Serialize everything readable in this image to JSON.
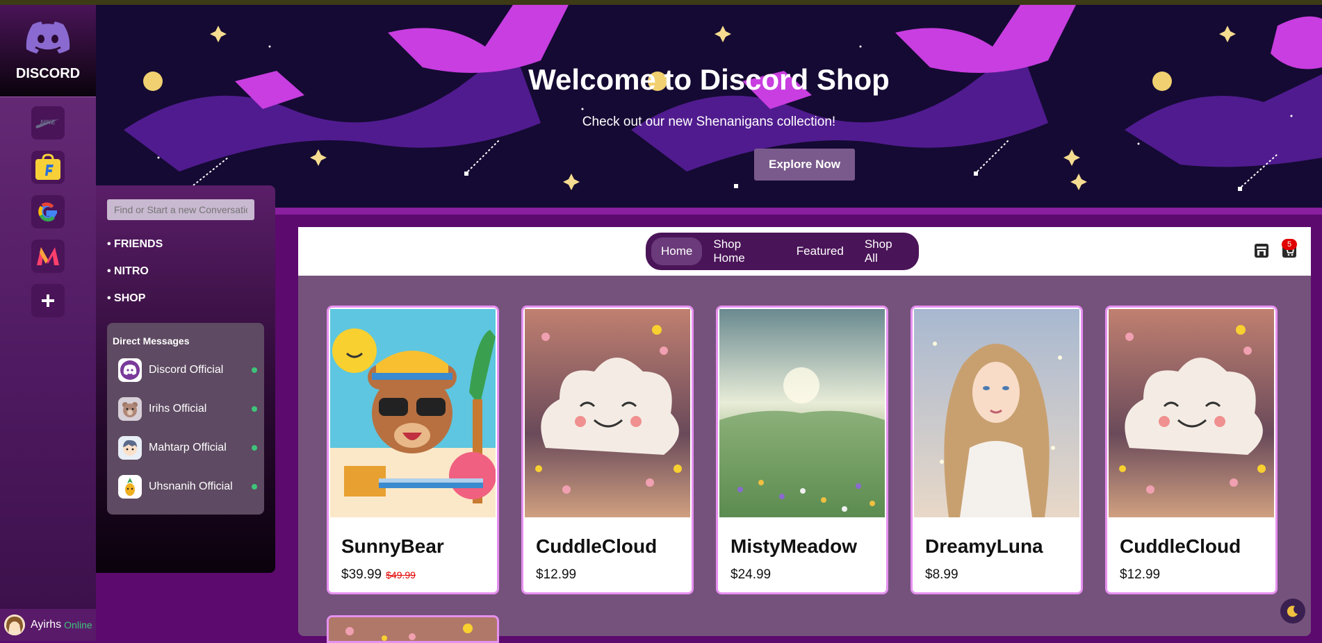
{
  "hero": {
    "title": "Welcome to Discord Shop",
    "subtitle": "Check out our new Shenanigans collection!",
    "cta_label": "Explore Now"
  },
  "rail": {
    "brand": "DISCORD",
    "servers": [
      {
        "icon": "nike-icon"
      },
      {
        "icon": "flipkart-icon"
      },
      {
        "icon": "google-icon"
      },
      {
        "icon": "myntra-icon"
      },
      {
        "icon": "add-server-icon"
      }
    ],
    "user": {
      "name": "Ayirhs",
      "status": "Online"
    }
  },
  "sidebar": {
    "search_placeholder": "Find or Start a new Conversation",
    "links": [
      "• FRIENDS",
      "• NITRO",
      "• SHOP"
    ],
    "dm_title": "Direct Messages",
    "dms": [
      {
        "name": "Discord Official",
        "icon": "discord-avatar-icon"
      },
      {
        "name": "Irihs Official",
        "icon": "bear-avatar-icon"
      },
      {
        "name": "Mahtarp Official",
        "icon": "boy-avatar-icon"
      },
      {
        "name": "Uhsnanih Official",
        "icon": "pineapple-avatar-icon"
      }
    ]
  },
  "nav": {
    "tabs": [
      "Home",
      "Shop Home",
      "Featured",
      "Shop All"
    ],
    "active_tab": "Home",
    "cart_count": "5"
  },
  "products": [
    {
      "name": "SunnyBear",
      "price": "$39.99",
      "old_price": "$49.99",
      "image": "sunny-bear-image"
    },
    {
      "name": "CuddleCloud",
      "price": "$12.99",
      "old_price": "",
      "image": "cuddle-cloud-image"
    },
    {
      "name": "MistyMeadow",
      "price": "$24.99",
      "old_price": "",
      "image": "misty-meadow-image"
    },
    {
      "name": "DreamyLuna",
      "price": "$8.99",
      "old_price": "",
      "image": "dreamy-luna-image"
    },
    {
      "name": "CuddleCloud",
      "price": "$12.99",
      "old_price": "",
      "image": "cuddle-cloud-image"
    }
  ],
  "colors": {
    "accent": "#4a1458",
    "page_bg": "#5c0a6e",
    "card_border": "#e690f0",
    "online": "#3ec47a",
    "sale": "#e00000"
  }
}
